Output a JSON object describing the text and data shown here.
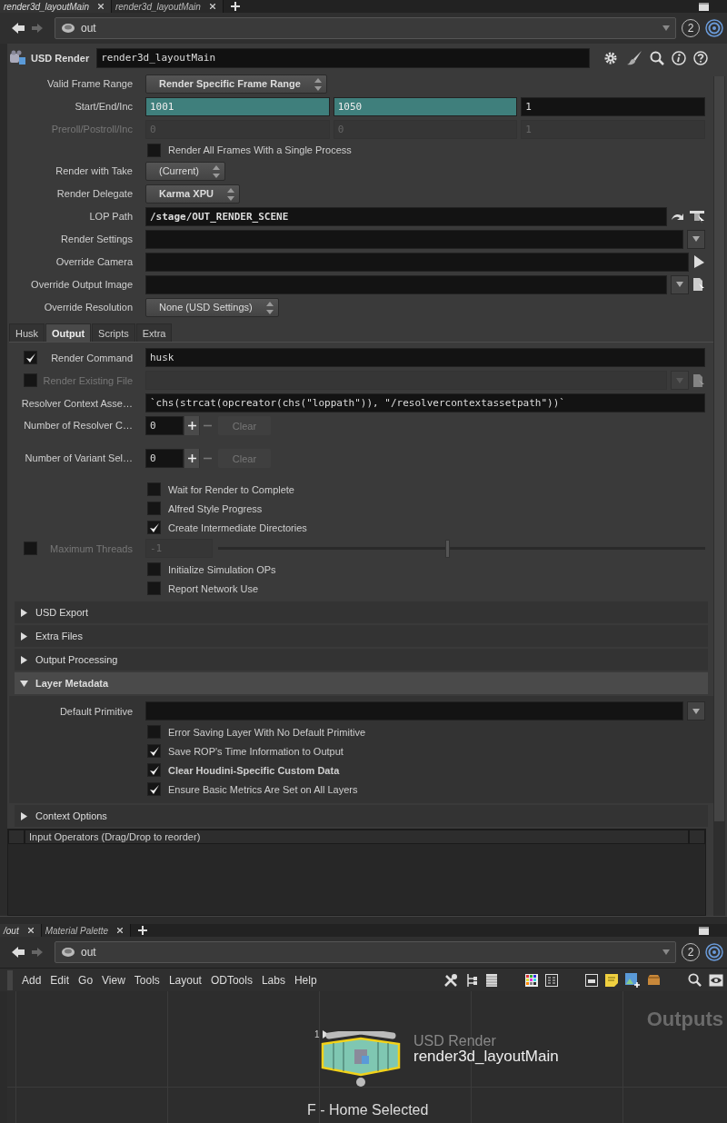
{
  "pane_tabs": [
    {
      "label": "render3d_layoutMain",
      "selected": true
    },
    {
      "label": "render3d_layoutMain",
      "selected": false
    }
  ],
  "path_bar": {
    "path": "out",
    "badge": "2"
  },
  "node_header": {
    "type": "USD Render",
    "name": "render3d_layoutMain"
  },
  "params": [
    {
      "kind": "menu",
      "label": "Valid Frame Range",
      "value": "Render Specific Frame Range",
      "bold": true
    },
    {
      "kind": "triple",
      "label": "Start/End/Inc",
      "values": [
        "1001",
        "1050",
        "1"
      ],
      "keyed": [
        true,
        true,
        false
      ],
      "disabled": false
    },
    {
      "kind": "triple",
      "label": "Preroll/Postroll/Inc",
      "values": [
        "0",
        "0",
        "1"
      ],
      "disabled": true
    },
    {
      "kind": "checkbox",
      "label": "Render All Frames With a Single Process",
      "checked": false,
      "bold": false
    },
    {
      "kind": "menu",
      "label": "Render with Take",
      "value": "(Current)",
      "bold": false
    },
    {
      "kind": "menu",
      "label": "Render Delegate",
      "value": "Karma XPU",
      "bold": true
    },
    {
      "kind": "node_path",
      "label": "LOP Path",
      "value": "/stage/OUT_RENDER_SCENE",
      "bold": true,
      "disabled": false
    },
    {
      "kind": "menu_string",
      "label": "Render Settings",
      "disabled": false
    },
    {
      "kind": "object_path",
      "label": "Override Camera",
      "disabled": false
    },
    {
      "kind": "file_path",
      "label": "Override Output Image",
      "disabled": false
    },
    {
      "kind": "menu",
      "label": "Override Resolution",
      "value": "None (USD Settings)",
      "bold": false
    }
  ],
  "parm_tabs": [
    {
      "label": "Husk",
      "selected": false
    },
    {
      "label": "Output",
      "selected": true
    },
    {
      "label": "Scripts",
      "selected": false
    },
    {
      "label": "Extra",
      "selected": false
    }
  ],
  "output_params": [
    {
      "kind": "string",
      "label": "Render Command",
      "value": "husk",
      "checked": true,
      "disabled": false
    },
    {
      "kind": "file_path",
      "label": "Render Existing File",
      "checked": false,
      "disabled": true
    },
    {
      "kind": "string",
      "label": "Resolver Context Asse…",
      "value": "`chs(strcat(opcreator(chs(\"loppath\")), \"/resolvercontextassetpath\"))`",
      "disabled": false
    },
    {
      "kind": "multiparm",
      "label": "Number of Resolver C…",
      "value": "0",
      "clear": "Clear"
    },
    {
      "kind": "multiparm",
      "label": "Number of Variant Sel…",
      "value": "0",
      "clear": "Clear"
    },
    {
      "kind": "checkbox",
      "label": "Wait for Render to Complete",
      "checked": false,
      "bold": false
    },
    {
      "kind": "checkbox",
      "label": "Alfred Style Progress",
      "checked": false,
      "bold": false
    },
    {
      "kind": "checkbox",
      "label": "Create Intermediate Directories",
      "checked": true,
      "bold": false
    },
    {
      "kind": "slider",
      "label": "Maximum Threads",
      "value": "-1",
      "level": 0.47,
      "checked": false,
      "disabled": true
    },
    {
      "kind": "checkbox",
      "label": "Initialize Simulation OPs",
      "checked": false,
      "bold": false
    },
    {
      "kind": "checkbox",
      "label": "Report Network Use",
      "checked": false,
      "bold": false
    }
  ],
  "folders": [
    {
      "label": "USD Export",
      "expanded": false
    },
    {
      "label": "Extra Files",
      "expanded": false
    },
    {
      "label": "Output Processing",
      "expanded": false
    },
    {
      "label": "Layer Metadata",
      "expanded": true,
      "params": [
        {
          "kind": "menu_string",
          "label": "Default Primitive",
          "disabled": false
        },
        {
          "kind": "checkbox",
          "label": "Error Saving Layer With No Default Primitive",
          "checked": false,
          "bold": false
        },
        {
          "kind": "checkbox",
          "label": "Save ROP's Time Information to Output",
          "checked": true,
          "bold": false
        },
        {
          "kind": "checkbox",
          "label": "Clear Houdini-Specific Custom Data",
          "checked": true,
          "bold": true
        },
        {
          "kind": "checkbox",
          "label": "Ensure Basic Metrics Are Set on All Layers",
          "checked": true,
          "bold": false
        }
      ]
    },
    {
      "label": "Context Options",
      "expanded": false
    }
  ],
  "input_operators": {
    "header": "Input Operators (Drag/Drop to reorder)"
  },
  "network": {
    "tabs": [
      {
        "label": "/out",
        "selected": true
      },
      {
        "label": "Material Palette",
        "selected": false
      }
    ],
    "path": "out",
    "badge": "2",
    "menus": [
      "Add",
      "Edit",
      "Go",
      "View",
      "Tools",
      "Layout",
      "ODTools",
      "Labs",
      "Help"
    ],
    "context_label": "Outputs",
    "node": {
      "type": "USD Render",
      "name": "render3d_layoutMain",
      "input": "1",
      "selected": true
    },
    "status": "F - Home Selected"
  }
}
